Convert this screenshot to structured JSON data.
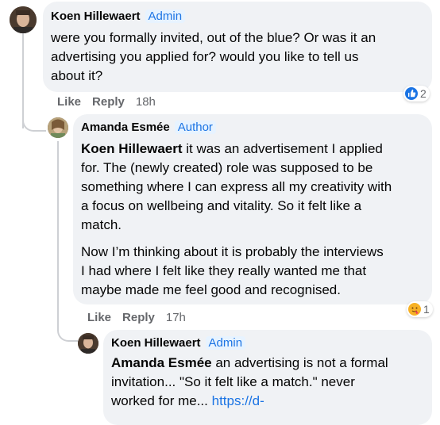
{
  "comments": [
    {
      "author": "Koen Hillewaert",
      "badge": "Admin",
      "lines": [
        "were you formally invited, out of the blue? Or was it an",
        "advertising you applied for? would you like to tell us",
        "about it?"
      ],
      "actions": {
        "like": "Like",
        "reply": "Reply",
        "time": "18h"
      },
      "reaction": {
        "icon": "like-icon",
        "count": "2",
        "color": "#1b74e4"
      }
    },
    {
      "author": "Amanda Esmée",
      "badge": "Author",
      "mention": "Koen Hillewaert",
      "first_line_rest": " it was an advertisement I applied",
      "lines": [
        "for. The (newly created) role was supposed to be",
        "something where I can express all my creativity with",
        "a focus on wellbeing and vitality. So it felt like a",
        "match."
      ],
      "para2": [
        "Now I’m thinking about it is probably the interviews",
        "I had where I felt like they really wanted me that",
        "maybe made me feel good and recognised."
      ],
      "actions": {
        "like": "Like",
        "reply": "Reply",
        "time": "17h"
      },
      "reaction": {
        "icon": "care-icon",
        "count": "1",
        "color": "#f7b125"
      }
    },
    {
      "author": "Koen Hillewaert",
      "badge": "Admin",
      "mention": "Amanda Esmée",
      "first_line_rest": " an advertising is not a formal",
      "lines": [
        "invitation... \"So it felt like a match.\" never"
      ],
      "last_line_text": "worked for me... ",
      "link": "https://d-"
    }
  ]
}
